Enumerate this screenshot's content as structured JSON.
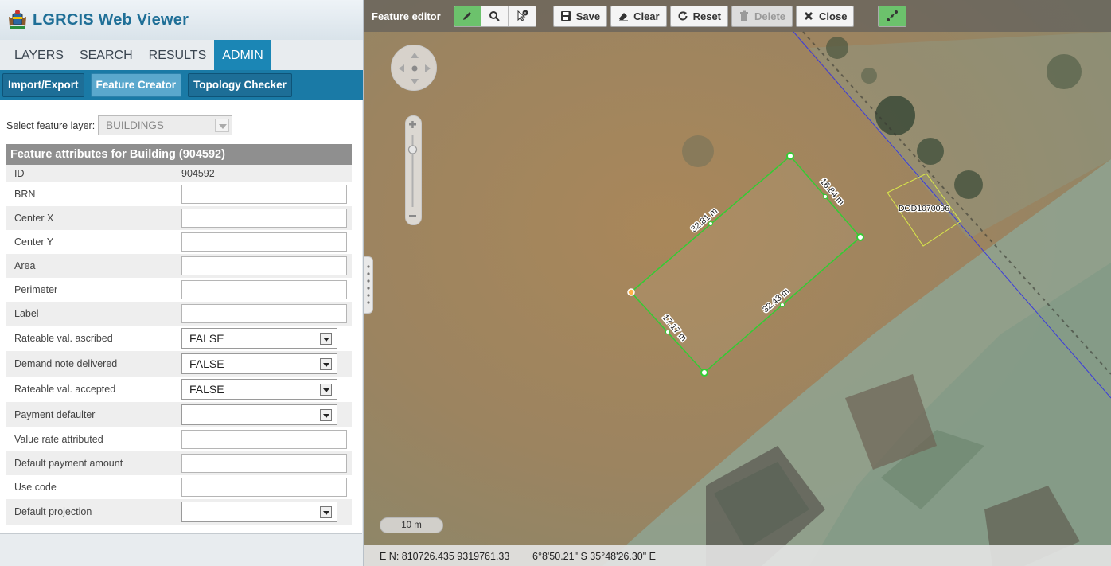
{
  "app": {
    "title": "LGRCIS Web Viewer"
  },
  "main_tabs": [
    {
      "label": "LAYERS",
      "active": false
    },
    {
      "label": "SEARCH",
      "active": false
    },
    {
      "label": "RESULTS",
      "active": false
    },
    {
      "label": "ADMIN",
      "active": true
    }
  ],
  "sub_tabs": [
    {
      "label": "Import/Export",
      "active": false
    },
    {
      "label": "Feature Creator",
      "active": true
    },
    {
      "label": "Topology Checker",
      "active": false
    }
  ],
  "layer_select": {
    "label": "Select feature layer:",
    "value": "BUILDINGS"
  },
  "attributes": {
    "header": "Feature attributes for Building (904592)",
    "rows": [
      {
        "label": "ID",
        "type": "text",
        "value": "904592"
      },
      {
        "label": "BRN",
        "type": "input",
        "value": ""
      },
      {
        "label": "Center X",
        "type": "input",
        "value": ""
      },
      {
        "label": "Center Y",
        "type": "input",
        "value": ""
      },
      {
        "label": "Area",
        "type": "input",
        "value": ""
      },
      {
        "label": "Perimeter",
        "type": "input",
        "value": ""
      },
      {
        "label": "Label",
        "type": "input",
        "value": ""
      },
      {
        "label": "Rateable val. ascribed",
        "type": "select",
        "value": "FALSE"
      },
      {
        "label": "Demand note delivered",
        "type": "select",
        "value": "FALSE"
      },
      {
        "label": "Rateable val. accepted",
        "type": "select",
        "value": "FALSE"
      },
      {
        "label": "Payment defaulter",
        "type": "select",
        "value": ""
      },
      {
        "label": "Value rate attributed",
        "type": "input",
        "value": ""
      },
      {
        "label": "Default payment amount",
        "type": "input",
        "value": ""
      },
      {
        "label": "Use code",
        "type": "input",
        "value": ""
      },
      {
        "label": "Default projection",
        "type": "select",
        "value": ""
      }
    ]
  },
  "toolbar": {
    "title": "Feature editor",
    "tools": [
      "pencil-icon",
      "search-icon",
      "info-pointer-icon"
    ],
    "save_label": "Save",
    "clear_label": "Clear",
    "reset_label": "Reset",
    "delete_label": "Delete",
    "close_label": "Close",
    "snap_icon": "snap-icon"
  },
  "map": {
    "edge_labels": [
      "32.81 m",
      "16.84 m",
      "32.43 m",
      "17.17 m"
    ],
    "parcel_label": "DOD1070096",
    "scale_label": "10 m",
    "coord_en": "E N: 810726.435 9319761.33",
    "coord_geo": "6°8'50.21\" S 35°48'26.30\" E",
    "colors": {
      "edit_polygon": "#33cc33",
      "parcel": "#d8e64a",
      "boundary_line": "#3b3bdc"
    }
  }
}
